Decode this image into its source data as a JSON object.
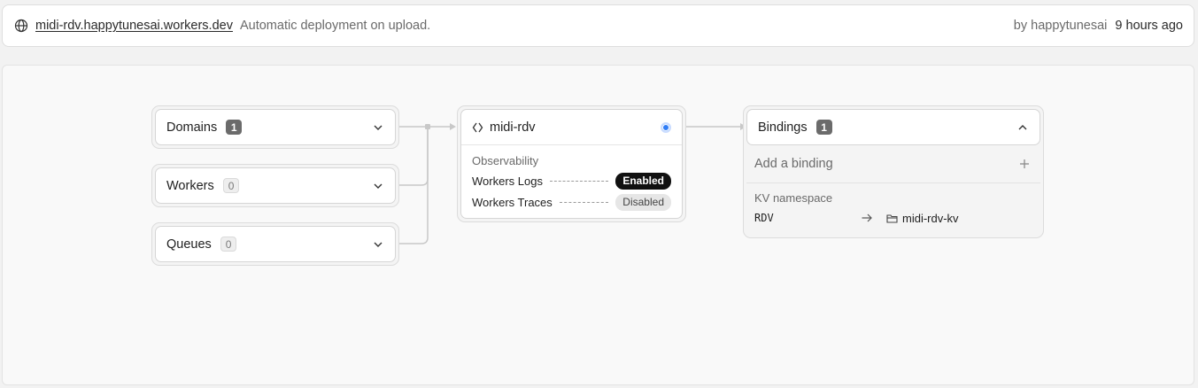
{
  "topbar": {
    "url": "midi-rdv.happytunesai.workers.dev",
    "message": "Automatic deployment on upload.",
    "by": "by happytunesai",
    "time_ago": "9 hours ago"
  },
  "triggers": [
    {
      "label": "Domains",
      "count": "1"
    },
    {
      "label": "Workers",
      "count": "0"
    },
    {
      "label": "Queues",
      "count": "0"
    }
  ],
  "worker": {
    "name": "midi-rdv",
    "observability_label": "Observability",
    "rows": [
      {
        "label": "Workers Logs",
        "status": "Enabled"
      },
      {
        "label": "Workers Traces",
        "status": "Disabled"
      }
    ]
  },
  "bindings": {
    "label": "Bindings",
    "count": "1",
    "add_label": "Add a binding",
    "section_title": "KV namespace",
    "items": [
      {
        "key": "RDV",
        "value": "midi-rdv-kv"
      }
    ]
  },
  "colors": {
    "accent_dot": "#2f7df6",
    "enabled_pill": "#111111",
    "badge_dark": "#6b6b6b"
  },
  "icons": {
    "globe": "globe-icon",
    "chevron": "chevron-down-icon",
    "chevron_up": "chevron-up-icon",
    "worker": "diamond-code-icon",
    "arrow": "arrow-right-icon",
    "folder": "folder-icon",
    "plus": "plus-icon"
  }
}
